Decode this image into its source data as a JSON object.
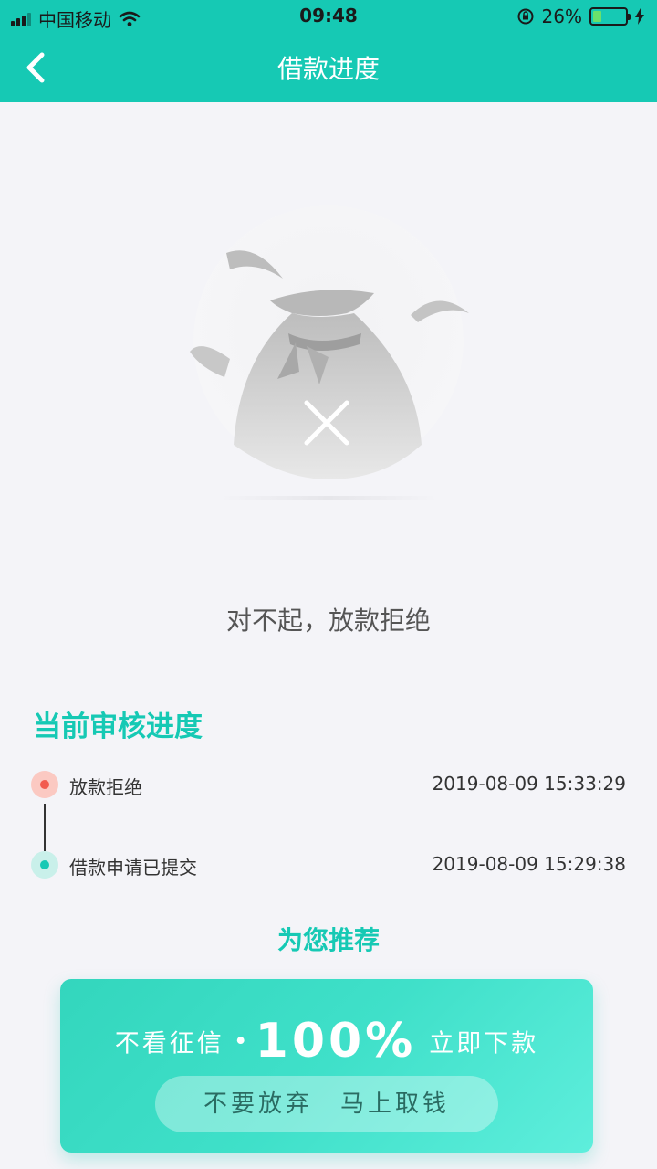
{
  "status_bar": {
    "carrier": "中国移动",
    "time": "09:48",
    "battery": "26%",
    "battery_level": 0.26
  },
  "nav": {
    "title": "借款进度",
    "back_icon": "chevron-left-icon"
  },
  "result": {
    "icon": "money-bag-x-icon",
    "message": "对不起，放款拒绝"
  },
  "progress": {
    "title": "当前审核进度",
    "items": [
      {
        "label": "放款拒绝",
        "time": "2019-08-09 15:33:29",
        "color": "#f25b4e"
      },
      {
        "label": "借款申请已提交",
        "time": "2019-08-09 15:29:38",
        "color": "#16c9b4"
      }
    ]
  },
  "recommend": {
    "title": "为您推荐",
    "left_text": "不看征信",
    "dot": "•",
    "big_text": "100%",
    "right_text": "立即下款",
    "button_label": "不要放弃　马上取钱"
  },
  "colors": {
    "accent": "#16c9b4",
    "reject": "#f25b4e"
  }
}
